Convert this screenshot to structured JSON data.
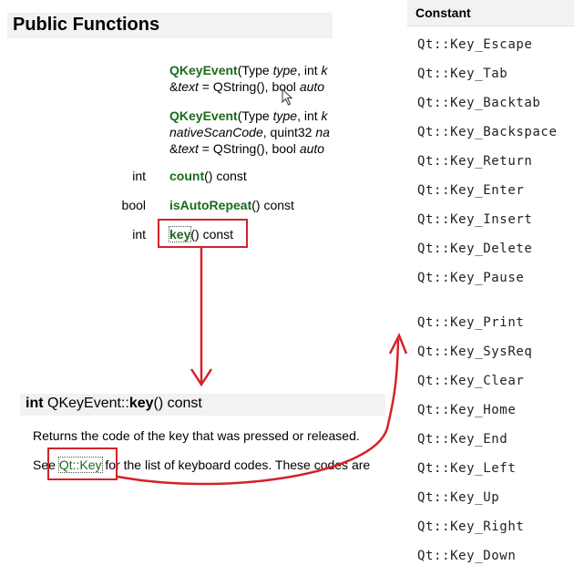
{
  "section": {
    "title": "Public Functions"
  },
  "functions": {
    "ctor1": {
      "name": "QKeyEvent",
      "line1_rest_a": "(Type ",
      "line1_type": "type",
      "line1_rest_b": ", int ",
      "line1_trunc": "k",
      "line2_a": "&",
      "line2_text": "text",
      "line2_b": " = QString(), bool ",
      "line2_auto": "auto"
    },
    "ctor2": {
      "name": "QKeyEvent",
      "line1_rest_a": "(Type ",
      "line1_type": "type",
      "line1_rest_b": ", int ",
      "line1_trunc": "k",
      "line2_native": "nativeScanCode",
      "line2_b": ", quint32 ",
      "line2_na": "na",
      "line3_a": "&",
      "line3_text": "text",
      "line3_b": " = QString(), bool ",
      "line3_auto": "auto"
    },
    "count": {
      "ret": "int",
      "name": "count",
      "rest": "() const"
    },
    "isAutoRepeat": {
      "ret": "bool",
      "name": "isAutoRepeat",
      "rest": "() const"
    },
    "key": {
      "ret": "int",
      "name": "key",
      "rest": "() const"
    }
  },
  "detail": {
    "ret": "int",
    "cls": "QKeyEvent::",
    "name": "key",
    "rest": "() const",
    "desc1": "Returns the code of the key that was pressed or released.",
    "desc2_a": "See ",
    "desc2_link": "Qt::Key",
    "desc2_b": " for the list of keyboard codes. These codes are"
  },
  "table": {
    "header": "Constant",
    "items": [
      "Qt::Key_Escape",
      "Qt::Key_Tab",
      "Qt::Key_Backtab",
      "Qt::Key_Backspace",
      "Qt::Key_Return",
      "Qt::Key_Enter",
      "Qt::Key_Insert",
      "Qt::Key_Delete",
      "Qt::Key_Pause",
      "Qt::Key_Print",
      "Qt::Key_SysReq",
      "Qt::Key_Clear",
      "Qt::Key_Home",
      "Qt::Key_End",
      "Qt::Key_Left",
      "Qt::Key_Up",
      "Qt::Key_Right",
      "Qt::Key_Down"
    ]
  },
  "colors": {
    "link": "#1a6b1a",
    "highlight": "#d3222a",
    "bar": "#f2f2f2"
  },
  "icons": {
    "cursor": "mouse-pointer-icon"
  }
}
